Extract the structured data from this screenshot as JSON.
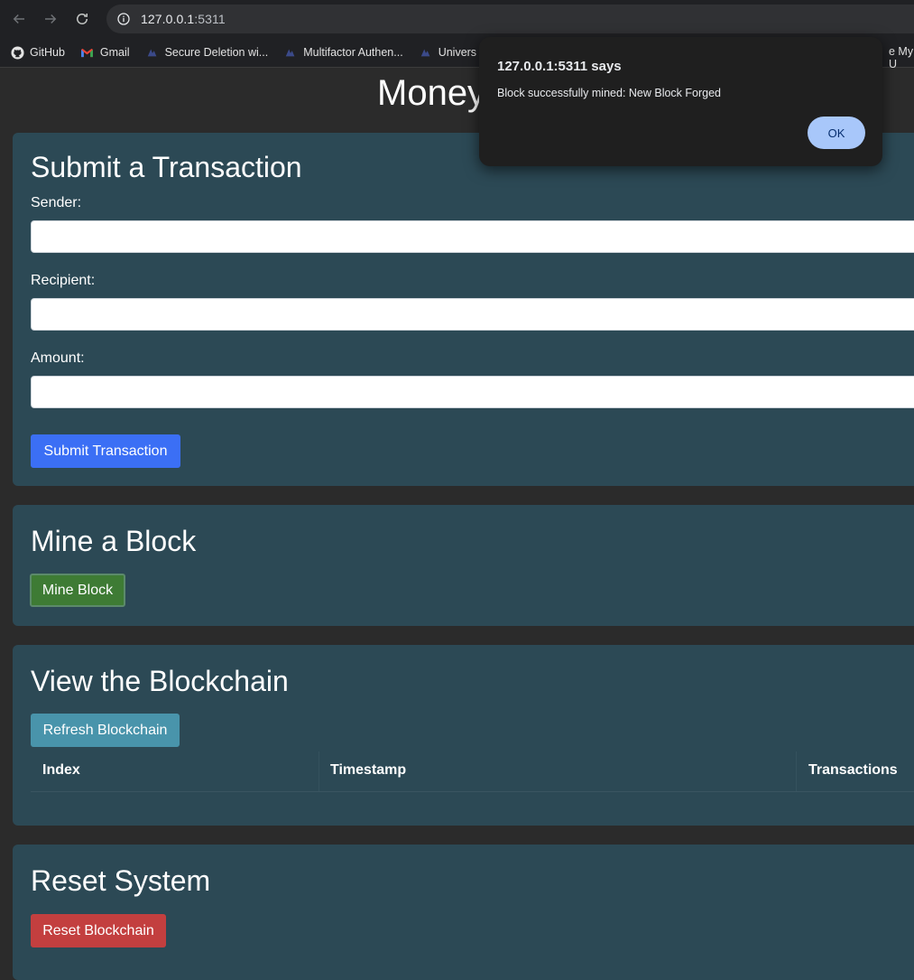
{
  "browser": {
    "url_host": "127.0.0.1",
    "url_port": ":5311",
    "bookmarks": [
      {
        "label": "GitHub",
        "icon": "github-icon"
      },
      {
        "label": "Gmail",
        "icon": "gmail-icon"
      },
      {
        "label": "Secure Deletion wi...",
        "icon": "bookmark-site-icon"
      },
      {
        "label": "Multifactor Authen...",
        "icon": "bookmark-site-icon"
      },
      {
        "label": "Univers",
        "icon": "bookmark-site-icon"
      }
    ],
    "bookmark_truncated": "e My U"
  },
  "page": {
    "title": "Money Transfer System"
  },
  "transaction": {
    "heading": "Submit a Transaction",
    "sender_label": "Sender:",
    "sender_value": "",
    "recipient_label": "Recipient:",
    "recipient_value": "",
    "amount_label": "Amount:",
    "amount_value": "",
    "submit_label": "Submit Transaction"
  },
  "mine": {
    "heading": "Mine a Block",
    "button_label": "Mine Block"
  },
  "chain": {
    "heading": "View the Blockchain",
    "refresh_label": "Refresh Blockchain",
    "columns": [
      "Index",
      "Timestamp",
      "Transactions"
    ]
  },
  "reset": {
    "heading": "Reset System",
    "button_label": "Reset Blockchain"
  },
  "dialog": {
    "title": "127.0.0.1:5311 says",
    "message": "Block successfully mined: New Block Forged",
    "ok_label": "OK"
  },
  "colors": {
    "card_bg": "#2c4955",
    "primary": "#3b6ff5",
    "success": "#3e7b34",
    "info": "#4994ab",
    "danger": "#c33f3f"
  }
}
